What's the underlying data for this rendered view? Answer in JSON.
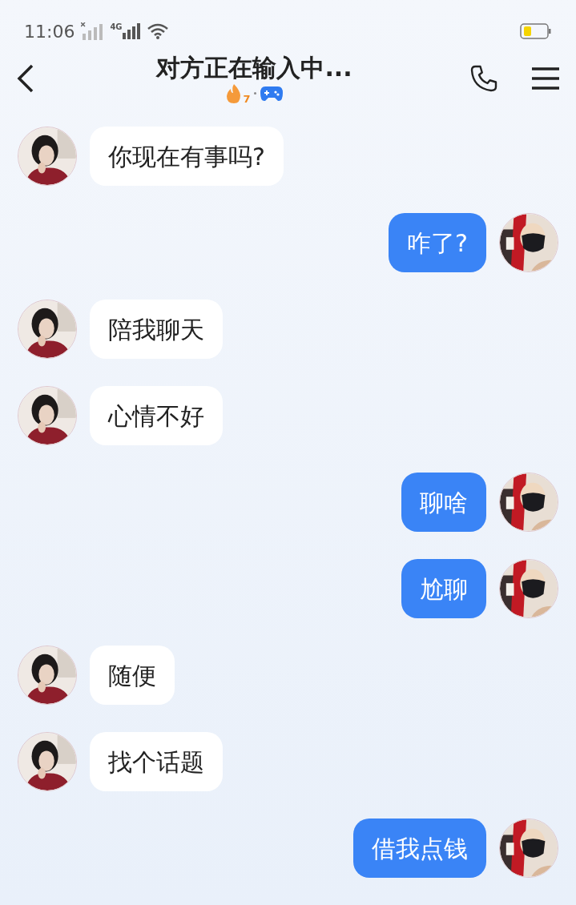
{
  "status_bar": {
    "time": "11:06",
    "network": "4G"
  },
  "header": {
    "title": "对方正在输入中...",
    "streak": "7"
  },
  "messages": [
    {
      "kind": "incoming",
      "text": "你现在有事吗?"
    },
    {
      "kind": "outgoing",
      "text": "咋了?"
    },
    {
      "kind": "incoming",
      "text": "陪我聊天"
    },
    {
      "kind": "incoming",
      "text": "心情不好"
    },
    {
      "kind": "outgoing",
      "text": "聊啥"
    },
    {
      "kind": "outgoing",
      "text": "尬聊"
    },
    {
      "kind": "incoming",
      "text": "随便"
    },
    {
      "kind": "incoming",
      "text": "找个话题"
    },
    {
      "kind": "outgoing",
      "text": "借我点钱"
    }
  ]
}
